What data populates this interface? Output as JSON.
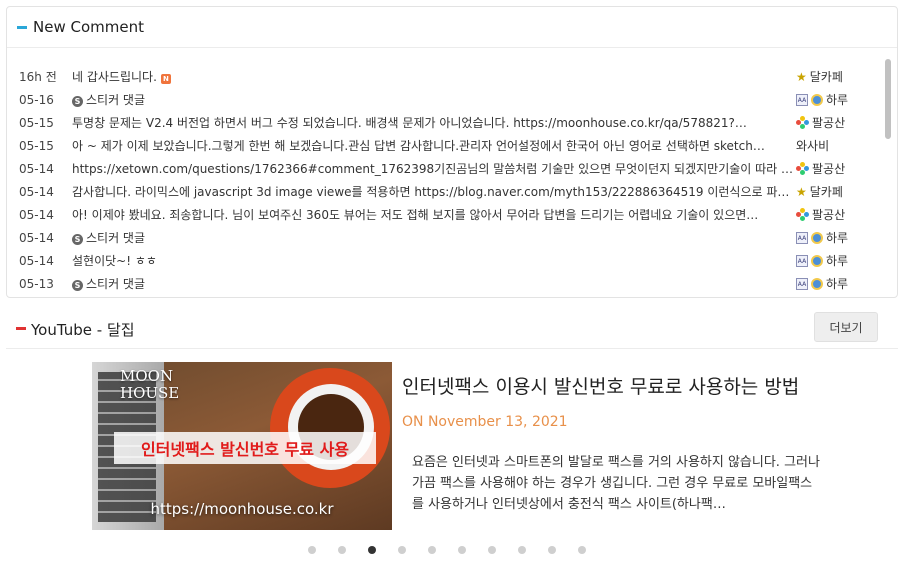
{
  "new_comment": {
    "title": "New Comment",
    "rows": [
      {
        "date": "16h 전",
        "text": "네 갑사드립니다.",
        "sticker": false,
        "new": true,
        "user": "달카페",
        "icons": [
          "star"
        ]
      },
      {
        "date": "05-16",
        "text": "스티커 댓글",
        "sticker": true,
        "new": false,
        "user": "하루",
        "icons": [
          "mini",
          "medal"
        ]
      },
      {
        "date": "05-15",
        "text": "투명창 문제는 V2.4 버전업 하면서 버그 수정 되었습니다. 배경색 문제가 아니었습니다. https://moonhouse.co.kr/qa/578821?…",
        "sticker": false,
        "new": false,
        "user": "팔공산",
        "icons": [
          "pin"
        ]
      },
      {
        "date": "05-15",
        "text": "아 ~ 제가 이제 보았습니다.그렇게 한번 해 보겠습니다.관심 답변 감사합니다.관리자 언어설정에서 한국어 아닌 영어로 선택하면 sketch…",
        "sticker": false,
        "new": false,
        "user": "와사비",
        "icons": []
      },
      {
        "date": "05-14",
        "text": "https://xetown.com/questions/1762366#comment_1762398기진곰님의 말씀처럼 기술만 있으면 무엇이던지 되겠지만기술이 따라 주…",
        "sticker": false,
        "new": false,
        "user": "팔공산",
        "icons": [
          "pin"
        ]
      },
      {
        "date": "05-14",
        "text": "감사합니다. 라이믹스에 javascript 3d image viewe를 적용하면 https://blog.naver.com/myth153/222886364519 이런식으로 파노라…",
        "sticker": false,
        "new": false,
        "user": "달카페",
        "icons": [
          "star"
        ]
      },
      {
        "date": "05-14",
        "text": "아! 이제야 봤네요. 죄송합니다. 님이 보여주신 360도 뷰어는 저도 접해 보지를 않아서 무어라 답변을 드리기는 어렵네요 기술이 있으면…",
        "sticker": false,
        "new": false,
        "user": "팔공산",
        "icons": [
          "pin"
        ]
      },
      {
        "date": "05-14",
        "text": "스티커 댓글",
        "sticker": true,
        "new": false,
        "user": "하루",
        "icons": [
          "mini",
          "medal"
        ]
      },
      {
        "date": "05-14",
        "text": "설현이닷~! ㅎㅎ",
        "sticker": false,
        "new": false,
        "user": "하루",
        "icons": [
          "mini",
          "medal"
        ]
      },
      {
        "date": "05-13",
        "text": "스티커 댓글",
        "sticker": true,
        "new": false,
        "user": "하루",
        "icons": [
          "mini",
          "medal"
        ]
      }
    ]
  },
  "youtube": {
    "title": "YouTube - 달집",
    "more_label": "더보기",
    "post": {
      "thumb_brand": "MOON\nHOUSE",
      "thumb_banner": "인터넷팩스 발신번호 무료 사용",
      "thumb_url": "https://moonhouse.co.kr",
      "title": "인터넷팩스 이용시 발신번호 무료로 사용하는 방법",
      "date": "ON November 13, 2021",
      "excerpt": "요즘은 인터넷과 스마트폰의 발달로 팩스를 거의 사용하지 않습니다. 그러나 가끔 팩스를 사용해야 하는 경우가 생깁니다. 그런 경우 무료로 모바일팩스를 사용하거나 인터넷상에서 충전식 팩스 사이트(하나팩…"
    },
    "dots": {
      "count": 10,
      "active_index": 2
    }
  }
}
